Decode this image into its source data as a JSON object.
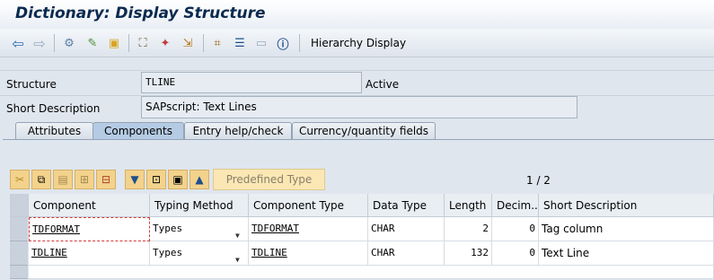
{
  "window": {
    "title": "Dictionary: Display Structure"
  },
  "toolbar": {
    "icons": [
      "back-icon",
      "forward-icon",
      "other-object-icon",
      "display-change-icon",
      "activate-icon",
      "where-used-icon",
      "object-list-icon",
      "navigate-icon",
      "hierarchy-icon",
      "append-icon",
      "layout-icon",
      "info-icon"
    ],
    "hierarchy_label": "Hierarchy Display"
  },
  "header": {
    "structure_label": "Structure",
    "structure_value": "TLINE",
    "status": "Active",
    "short_desc_label": "Short Description",
    "short_desc_value": "SAPscript: Text Lines"
  },
  "tabs": [
    {
      "label": "Attributes"
    },
    {
      "label": "Components",
      "active": true
    },
    {
      "label": "Entry help/check"
    },
    {
      "label": "Currency/quantity fields"
    }
  ],
  "table_toolbar": {
    "predefined_type_label": "Predefined Type",
    "page_indicator": "1 / 2"
  },
  "table": {
    "columns": [
      "Component",
      "Typing Method",
      "Component Type",
      "Data Type",
      "Length",
      "Decim...",
      "Short Description"
    ],
    "rows": [
      {
        "component": "TDFORMAT",
        "typing_method": "Types",
        "component_type": "TDFORMAT",
        "data_type": "CHAR",
        "length": "2",
        "decimals": "0",
        "short_description": "Tag column"
      },
      {
        "component": "TDLINE",
        "typing_method": "Types",
        "component_type": "TDLINE",
        "data_type": "CHAR",
        "length": "132",
        "decimals": "0",
        "short_description": "Text Line"
      }
    ]
  }
}
